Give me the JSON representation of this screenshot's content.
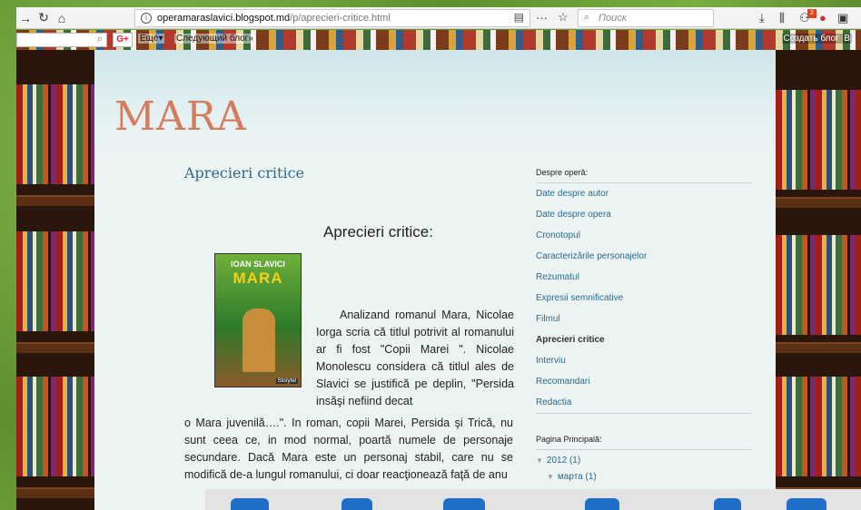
{
  "browser": {
    "url_domain": "operamaraslavici.blogspot.md",
    "url_path": "/p/aprecieri-critice.html",
    "search_placeholder": "Поиск",
    "icons": [
      "back-arrow-icon",
      "reload-icon",
      "home-icon",
      "info-icon",
      "reader-icon",
      "more-icon",
      "star-icon",
      "search-icon",
      "download-icon",
      "library-icon",
      "extension-icon"
    ],
    "badge_count": "2"
  },
  "navbar": {
    "gplus": "G+",
    "more_label": "Ещё▾",
    "next_blog": "Следующий блог»",
    "create_blog": "Создать блог",
    "sign_in_fragment": "В"
  },
  "blog": {
    "title": "MARA",
    "post_title": "Aprecieri critice"
  },
  "content": {
    "heading": "Aprecieri critice:",
    "book_cover": {
      "author": "IOAN SLAVICI",
      "title": "MARA",
      "publisher": "Storytel"
    },
    "paragraph_1": "Analizand romanul Mara, Nicolae Iorga scria că titlul potrivit al romanului ar fi fost \"Copii Marei \". Nicolae Monolescu considera că titlul ales de Slavici se justifică pe deplin, \"Persida insăşi nefiind decat",
    "paragraph_2": "o Mara juvenilă….\". In roman, copii Marei, Persida şi Trică, nu sunt ceea ce, in mod normal, poartă numele de personaje secundare. Dacă Mara este un personaj stabil, care nu se modifică de-a lungul romanului, ci doar reacţionează faţă de anu"
  },
  "sidebar": {
    "section_title": "Despre operă:",
    "links": [
      "Date despre autor",
      "Date despre opera",
      "Cronotopul",
      "Caracterizările personajelor",
      "Rezumatul",
      "Expresii semnificative",
      "Filmul",
      "Aprecieri critice",
      "Interviu",
      "Recomandari",
      "Redactia"
    ],
    "active_link": "Aprecieri critice",
    "archive_title": "Pagina Principală:",
    "archive_year": "2012 (1)",
    "archive_month": "марта (1)"
  }
}
